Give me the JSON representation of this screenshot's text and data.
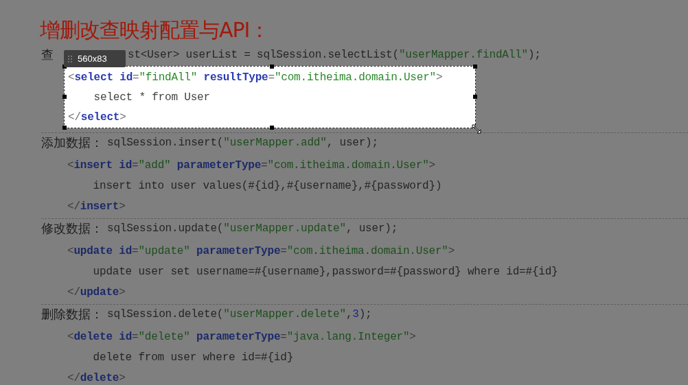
{
  "title": "增删改查映射配置与API：",
  "selection": {
    "size": "560x83"
  },
  "sections": [
    {
      "label": "查",
      "highlighted": true,
      "call": [
        {
          "kind": "plain",
          "text": "st<User> userList = sqlSession.selectList("
        },
        {
          "kind": "string",
          "text": "\"userMapper.findAll\""
        },
        {
          "kind": "plain",
          "text": ");"
        }
      ],
      "xml": [
        [
          {
            "kind": "punct",
            "text": "<"
          },
          {
            "kind": "tag",
            "text": "select"
          },
          {
            "kind": "attr",
            "text": " id"
          },
          {
            "kind": "punct",
            "text": "="
          },
          {
            "kind": "string",
            "text": "\"findAll\""
          },
          {
            "kind": "attr",
            "text": " resultType"
          },
          {
            "kind": "punct",
            "text": "="
          },
          {
            "kind": "string",
            "text": "\"com.itheima.domain.User\""
          },
          {
            "kind": "punct",
            "text": ">"
          }
        ],
        [
          {
            "kind": "plain",
            "text": "    select * from User"
          }
        ],
        [
          {
            "kind": "punct",
            "text": "</"
          },
          {
            "kind": "tag",
            "text": "select"
          },
          {
            "kind": "punct",
            "text": ">"
          }
        ]
      ]
    },
    {
      "label": "添加数据：",
      "highlighted": false,
      "call": [
        {
          "kind": "plain",
          "text": "sqlSession.insert("
        },
        {
          "kind": "string",
          "text": "\"userMapper.add\""
        },
        {
          "kind": "plain",
          "text": ", user);"
        }
      ],
      "xml": [
        [
          {
            "kind": "punct",
            "text": "<"
          },
          {
            "kind": "tag",
            "text": "insert"
          },
          {
            "kind": "attr",
            "text": " id"
          },
          {
            "kind": "punct",
            "text": "="
          },
          {
            "kind": "string",
            "text": "\"add\""
          },
          {
            "kind": "attr",
            "text": " parameterType"
          },
          {
            "kind": "punct",
            "text": "="
          },
          {
            "kind": "string",
            "text": "\"com.itheima.domain.User\""
          },
          {
            "kind": "punct",
            "text": ">"
          }
        ],
        [
          {
            "kind": "plain",
            "text": "    insert into user values(#{id},#{username},#{password})"
          }
        ],
        [
          {
            "kind": "punct",
            "text": "</"
          },
          {
            "kind": "tag",
            "text": "insert"
          },
          {
            "kind": "punct",
            "text": ">"
          }
        ]
      ]
    },
    {
      "label": "修改数据：",
      "highlighted": false,
      "call": [
        {
          "kind": "plain",
          "text": "sqlSession.update("
        },
        {
          "kind": "string",
          "text": "\"userMapper.update\""
        },
        {
          "kind": "plain",
          "text": ", user);"
        }
      ],
      "xml": [
        [
          {
            "kind": "punct",
            "text": "<"
          },
          {
            "kind": "tag",
            "text": "update"
          },
          {
            "kind": "attr",
            "text": " id"
          },
          {
            "kind": "punct",
            "text": "="
          },
          {
            "kind": "string",
            "text": "\"update\""
          },
          {
            "kind": "attr",
            "text": " parameterType"
          },
          {
            "kind": "punct",
            "text": "="
          },
          {
            "kind": "string",
            "text": "\"com.itheima.domain.User\""
          },
          {
            "kind": "punct",
            "text": ">"
          }
        ],
        [
          {
            "kind": "plain",
            "text": "    update user set username=#{username},password=#{password} where id=#{id}"
          }
        ],
        [
          {
            "kind": "punct",
            "text": "</"
          },
          {
            "kind": "tag",
            "text": "update"
          },
          {
            "kind": "punct",
            "text": ">"
          }
        ]
      ]
    },
    {
      "label": "删除数据：",
      "highlighted": false,
      "call": [
        {
          "kind": "plain",
          "text": "sqlSession.delete("
        },
        {
          "kind": "string",
          "text": "\"userMapper.delete\""
        },
        {
          "kind": "plain",
          "text": ","
        },
        {
          "kind": "number",
          "text": "3"
        },
        {
          "kind": "plain",
          "text": ");"
        }
      ],
      "xml": [
        [
          {
            "kind": "punct",
            "text": "<"
          },
          {
            "kind": "tag",
            "text": "delete"
          },
          {
            "kind": "attr",
            "text": " id"
          },
          {
            "kind": "punct",
            "text": "="
          },
          {
            "kind": "string",
            "text": "\"delete\""
          },
          {
            "kind": "attr",
            "text": " parameterType"
          },
          {
            "kind": "punct",
            "text": "="
          },
          {
            "kind": "string",
            "text": "\"java.lang.Integer\""
          },
          {
            "kind": "punct",
            "text": ">"
          }
        ],
        [
          {
            "kind": "plain",
            "text": "    delete from user where id=#{id}"
          }
        ],
        [
          {
            "kind": "punct",
            "text": "</"
          },
          {
            "kind": "tag",
            "text": "delete"
          },
          {
            "kind": "punct",
            "text": ">"
          }
        ]
      ]
    }
  ]
}
